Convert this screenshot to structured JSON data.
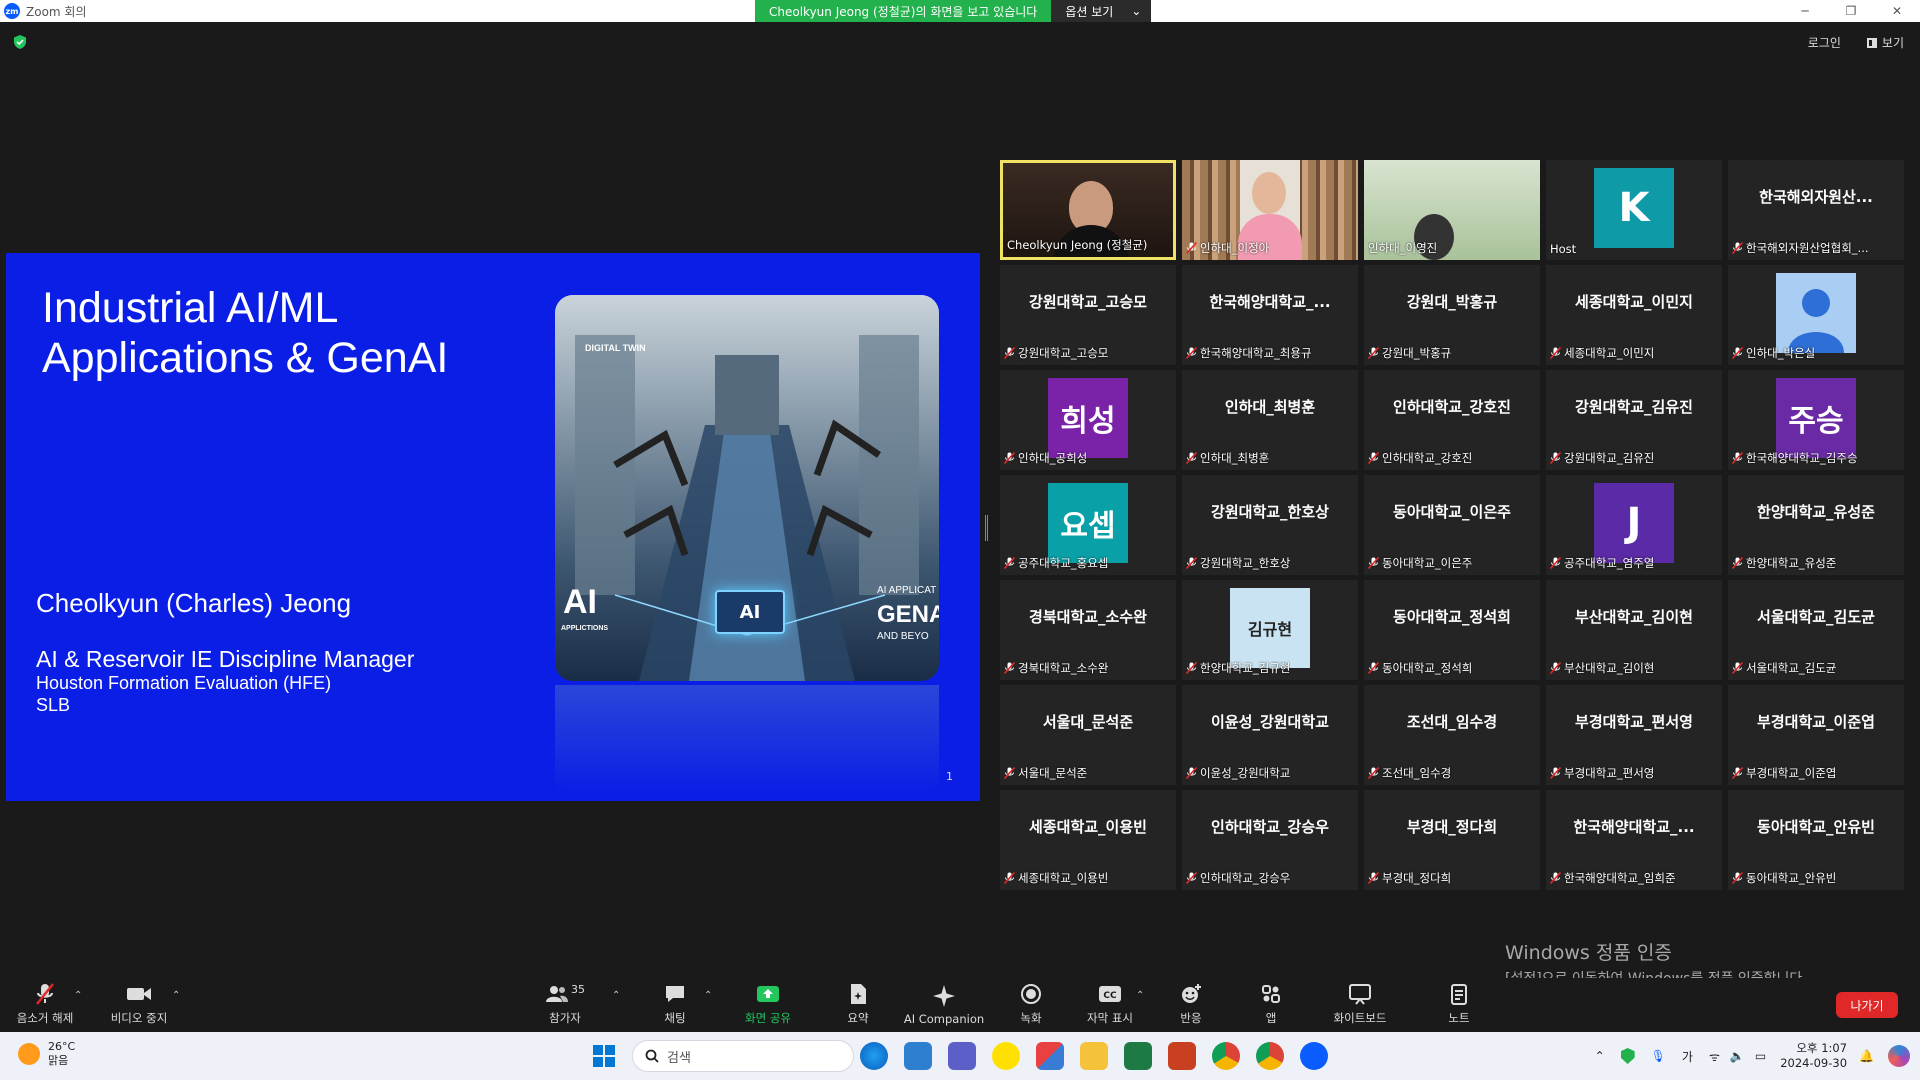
{
  "window": {
    "app_title": "Zoom 회의",
    "logo_text": "zm"
  },
  "share_bar": {
    "message": "Cheolkyun Jeong (정철균)의 화면을 보고 있습니다",
    "options_label": "옵션 보기"
  },
  "top_right": {
    "login_label": "로그인",
    "view_label": "보기"
  },
  "slide": {
    "title_line1": "Industrial AI/ML",
    "title_line2": "Applications & GenAI",
    "presenter": "Cheolkyun (Charles) Jeong",
    "role": "AI & Reservoir IE Discipline Manager",
    "org": "Houston Formation Evaluation (HFE)",
    "company": "SLB",
    "page_number": "1",
    "art_labels": {
      "digital_twin": "DIGITAL TWIN",
      "ai": "AI",
      "applictions": "APPLICTIONS",
      "chip": "AI",
      "ai_applic": "AI APPLICAT",
      "gena": "GENA",
      "beyo": "AND BEYO"
    }
  },
  "participants": [
    {
      "name": "Cheolkyun Jeong (정철균)",
      "kind": "video",
      "active": true,
      "muted": false
    },
    {
      "name": "인하대_이정아",
      "kind": "video",
      "muted": true
    },
    {
      "name": "인하대_이영진",
      "kind": "video",
      "muted": false
    },
    {
      "name": "Host",
      "kind": "avatar",
      "initial": "K",
      "color": "#0e9aa7",
      "muted": false
    },
    {
      "name": "한국해외자원산업협회_...",
      "center": "한국해외자원산...",
      "kind": "name",
      "muted": true
    },
    {
      "name": "강원대학교_고승모",
      "center": "강원대학교_고승모",
      "kind": "name",
      "muted": true
    },
    {
      "name": "한국해양대학교_최용규",
      "center": "한국해양대학교_...",
      "kind": "name",
      "muted": true
    },
    {
      "name": "강원대_박홍규",
      "center": "강원대_박홍규",
      "kind": "name",
      "muted": true
    },
    {
      "name": "세종대학교_이민지",
      "center": "세종대학교_이민지",
      "kind": "name",
      "muted": true
    },
    {
      "name": "인하대_박은실",
      "kind": "person",
      "muted": true
    },
    {
      "name": "인하대_공희성",
      "kind": "avatar",
      "initial": "희성",
      "color": "#7a22a8",
      "muted": true
    },
    {
      "name": "인하대_최병훈",
      "center": "인하대_최병훈",
      "kind": "name",
      "muted": true
    },
    {
      "name": "인하대학교_강호진",
      "center": "인하대학교_강호진",
      "kind": "name",
      "muted": true
    },
    {
      "name": "강원대학교_김유진",
      "center": "강원대학교_김유진",
      "kind": "name",
      "muted": true
    },
    {
      "name": "한국해양대학교_김주승",
      "kind": "avatar",
      "initial": "주승",
      "color": "#6a2aa6",
      "muted": true
    },
    {
      "name": "공주대학교_홍요셉",
      "kind": "avatar",
      "initial": "요셉",
      "color": "#0aa0a8",
      "muted": true
    },
    {
      "name": "강원대학교_한호상",
      "center": "강원대학교_한호상",
      "kind": "name",
      "muted": true
    },
    {
      "name": "동아대학교_이은주",
      "center": "동아대학교_이은주",
      "kind": "name",
      "muted": true
    },
    {
      "name": "공주대학교_염주열",
      "kind": "avatar",
      "initial": "J",
      "color": "#5b2aa6",
      "muted": true
    },
    {
      "name": "한양대학교_유성준",
      "center": "한양대학교_유성준",
      "kind": "name",
      "muted": true
    },
    {
      "name": "경북대학교_소수완",
      "center": "경북대학교_소수완",
      "kind": "name",
      "muted": true
    },
    {
      "name": "한양대학교_김규현",
      "kind": "avatar",
      "initial": "김규현",
      "color": "#c9e3f2",
      "text_color": "#222",
      "muted": true
    },
    {
      "name": "동아대학교_정석희",
      "center": "동아대학교_정석희",
      "kind": "name",
      "muted": true
    },
    {
      "name": "부산대학교_김이현",
      "center": "부산대학교_김이현",
      "kind": "name",
      "muted": true
    },
    {
      "name": "서울대학교_김도균",
      "center": "서울대학교_김도균",
      "kind": "name",
      "muted": true
    },
    {
      "name": "서울대_문석준",
      "center": "서울대_문석준",
      "kind": "name",
      "muted": true
    },
    {
      "name": "이윤성_강원대학교",
      "center": "이윤성_강원대학교",
      "kind": "name",
      "muted": true
    },
    {
      "name": "조선대_임수경",
      "center": "조선대_임수경",
      "kind": "name",
      "muted": true
    },
    {
      "name": "부경대학교_편서영",
      "center": "부경대학교_편서영",
      "kind": "name",
      "muted": true
    },
    {
      "name": "부경대학교_이준엽",
      "center": "부경대학교_이준엽",
      "kind": "name",
      "muted": true
    },
    {
      "name": "세종대학교_이용빈",
      "center": "세종대학교_이용빈",
      "kind": "name",
      "muted": true
    },
    {
      "name": "인하대학교_강승우",
      "center": "인하대학교_강승우",
      "kind": "name",
      "muted": true
    },
    {
      "name": "부경대_정다희",
      "center": "부경대_정다희",
      "kind": "name",
      "muted": true
    },
    {
      "name": "한국해양대학교_임희준",
      "center": "한국해양대학교_...",
      "kind": "name",
      "muted": true
    },
    {
      "name": "동아대학교_안유빈",
      "center": "동아대학교_안유빈",
      "kind": "name",
      "muted": true
    }
  ],
  "toolbar": {
    "unmute": "음소거 해제",
    "stop_video": "비디오 중지",
    "participants": "참가자",
    "participants_count": "35",
    "chat": "채팅",
    "share": "화면 공유",
    "summary": "요약",
    "companion": "AI Companion",
    "record": "녹화",
    "captions": "자막 표시",
    "reactions": "반응",
    "apps": "앱",
    "whiteboard": "화이트보드",
    "notes": "노트",
    "leave": "나가기"
  },
  "watermark": {
    "line1": "Windows 정품 인증",
    "line2": "[설정]으로 이동하여 Windows를 정품 인증합니다."
  },
  "taskbar": {
    "weather_temp": "26°C",
    "weather_desc": "맑음",
    "search_placeholder": "검색",
    "ime": "가",
    "time": "오후 1:07",
    "date": "2024-09-30"
  },
  "colors": {
    "slide_bg": "#0a1ee6",
    "share_green": "#22b14c",
    "leave_red": "#e02828",
    "active_border": "#f0e264"
  }
}
